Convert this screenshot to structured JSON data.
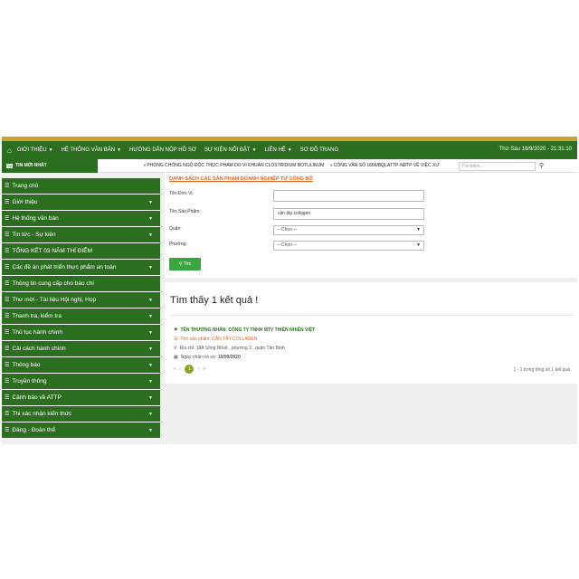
{
  "nav": {
    "items": [
      {
        "label": "GIỚI THIỆU",
        "caret": true
      },
      {
        "label": "HỆ THỐNG VĂN BẢN",
        "caret": true
      },
      {
        "label": "HƯỚNG DẪN NỘP HỒ SƠ",
        "caret": false
      },
      {
        "label": "SỰ KIỆN NỔI BẬT",
        "caret": true
      },
      {
        "label": "LIÊN HỆ",
        "caret": true
      },
      {
        "label": "SƠ ĐỒ TRANG",
        "caret": false
      }
    ],
    "datetime": "Thứ Sáu 18/9/2020 - 21:31:10"
  },
  "ticker": {
    "label": "TIN MỚI NHẤT",
    "item1": "PHÒNG CHỐNG NGỘ ĐỘC THỰC PHẨM DO VI KHUẨN CLOSTRIDIUM BOTULINUM",
    "item2": "CÔNG VĂN SỐ 1666/BQLATTP-NĐTP VỀ VIỆC XỬ",
    "search_placeholder": "Tìm kiếm..."
  },
  "sidebar": {
    "items": [
      {
        "label": "Trang chủ",
        "dropdown": false
      },
      {
        "label": "Giới thiệu",
        "dropdown": true
      },
      {
        "label": "Hệ thống văn bản",
        "dropdown": true
      },
      {
        "label": "Tin tức - Sự kiện",
        "dropdown": true
      },
      {
        "label": "TỔNG KẾT 03 NĂM THÍ ĐIỂM",
        "dropdown": false
      },
      {
        "label": "Các đề án phát triển thực phẩm an toàn",
        "dropdown": true
      },
      {
        "label": "Thông tin cung cấp cho báo chí",
        "dropdown": false
      },
      {
        "label": "Thư mời - Tài liệu Hội nghị, Họp",
        "dropdown": true
      },
      {
        "label": "Thanh tra, kiểm tra",
        "dropdown": true
      },
      {
        "label": "Thủ tục hành chính",
        "dropdown": true
      },
      {
        "label": "Cải cách hành chính",
        "dropdown": true
      },
      {
        "label": "Thông báo",
        "dropdown": true
      },
      {
        "label": "Truyền thông",
        "dropdown": true
      },
      {
        "label": "Cảnh báo về ATTP",
        "dropdown": true
      },
      {
        "label": "Thi xác nhận kiến thức",
        "dropdown": true
      },
      {
        "label": "Đảng - Đoàn thể",
        "dropdown": true
      }
    ]
  },
  "form": {
    "title": "DANH SÁCH CÁC SẢN PHẨM DOANH NGHIỆP TỰ CÔNG BỐ",
    "unit_label": "Tên Đơn Vị:",
    "unit_value": "",
    "product_label": "Tên Sản Phẩm:",
    "product_value": "cần tây collagen",
    "district_label": "Quận:",
    "district_value": "---Chọn---",
    "ward_label": "Phường:",
    "ward_value": "---Chọn---",
    "search_button": "Tìm"
  },
  "results": {
    "heading": "Tìm thấy 1 kết quả !",
    "company": "TÊN THƯƠNG NHÂN: CÔNG TY TNHH MTV THIÊN NHIÊN VIỆT",
    "product": "Tên sản phẩm: CẦN TÂY COLLAGEN",
    "address": "Địa chỉ: 18A Sông Nhuệ , phường 2 , quận Tân Bình",
    "date_label": "Ngày nhận hồ sơ:",
    "date_value": "10/09/2020",
    "current_page": "1",
    "pager_info": "1 - 1 trong tổng số 1 kết quả"
  },
  "colors": {
    "nav_green": "#2c6e1f",
    "accent_orange": "#e8601c",
    "button_green": "#3aa640",
    "top_stripe": "#c9a227"
  }
}
